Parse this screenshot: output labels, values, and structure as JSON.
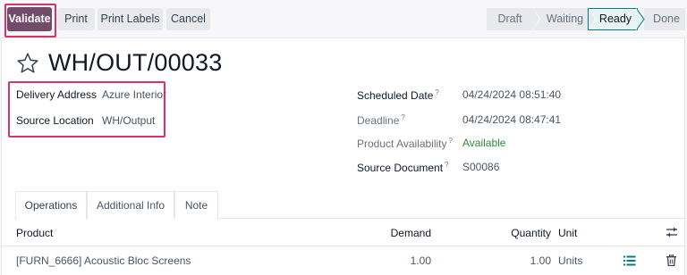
{
  "toolbar": {
    "validate_label": "Validate",
    "print_label": "Print",
    "print_labels_label": "Print Labels",
    "cancel_label": "Cancel"
  },
  "status": {
    "stages": [
      "Draft",
      "Waiting",
      "Ready",
      "Done"
    ],
    "active": "Ready"
  },
  "record": {
    "name": "WH/OUT/00033",
    "favorite": false
  },
  "fields": {
    "delivery_address_label": "Delivery Address",
    "delivery_address_value": "Azure Interior",
    "source_location_label": "Source Location",
    "source_location_value": "WH/Output",
    "scheduled_date_label": "Scheduled Date",
    "scheduled_date_value": "04/24/2024 08:51:40",
    "deadline_label": "Deadline",
    "deadline_value": "04/24/2024 08:47:41",
    "product_availability_label": "Product Availability",
    "product_availability_value": "Available",
    "source_document_label": "Source Document",
    "source_document_value": "S00086",
    "help_mark": "?"
  },
  "tabs": [
    "Operations",
    "Additional Info",
    "Note"
  ],
  "table": {
    "headers": {
      "product": "Product",
      "demand": "Demand",
      "quantity": "Quantity",
      "unit": "Unit"
    },
    "rows": [
      {
        "product": "[FURN_6666] Acoustic Bloc Screens",
        "demand": "1.00",
        "quantity": "1.00",
        "unit": "Units"
      }
    ]
  },
  "icons": {
    "favorite": "star-outline-icon",
    "column_settings": "sliders-icon",
    "details": "list-icon",
    "delete": "trash-icon"
  },
  "colors": {
    "primary": "#714b67",
    "highlight": "#d6336c",
    "active_stage_border": "#017e84",
    "available": "#2f8a3b",
    "details_icon": "#017e84"
  }
}
